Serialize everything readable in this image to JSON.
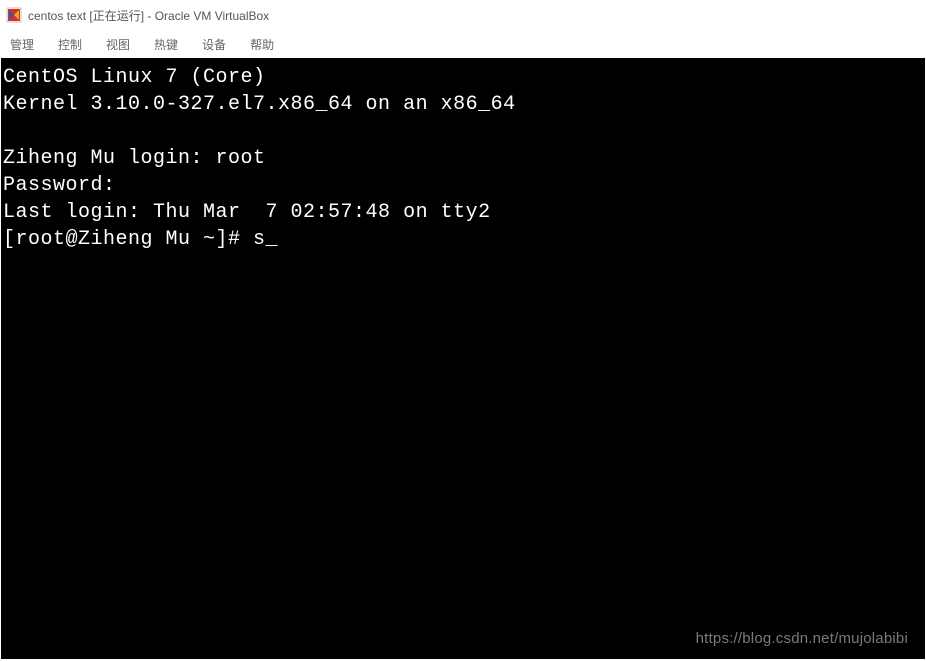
{
  "window": {
    "title": "centos text [正在运行] - Oracle VM VirtualBox",
    "icon": "virtualbox-icon"
  },
  "menu": {
    "items": [
      "管理",
      "控制",
      "视图",
      "热键",
      "设备",
      "帮助"
    ]
  },
  "terminal": {
    "lines": [
      "CentOS Linux 7 (Core)",
      "Kernel 3.10.0-327.el7.x86_64 on an x86_64",
      "",
      "Ziheng Mu login: root",
      "Password:",
      "Last login: Thu Mar  7 02:57:48 on tty2",
      "[root@Ziheng Mu ~]# s_"
    ]
  },
  "watermark": "https://blog.csdn.net/mujolabibi"
}
